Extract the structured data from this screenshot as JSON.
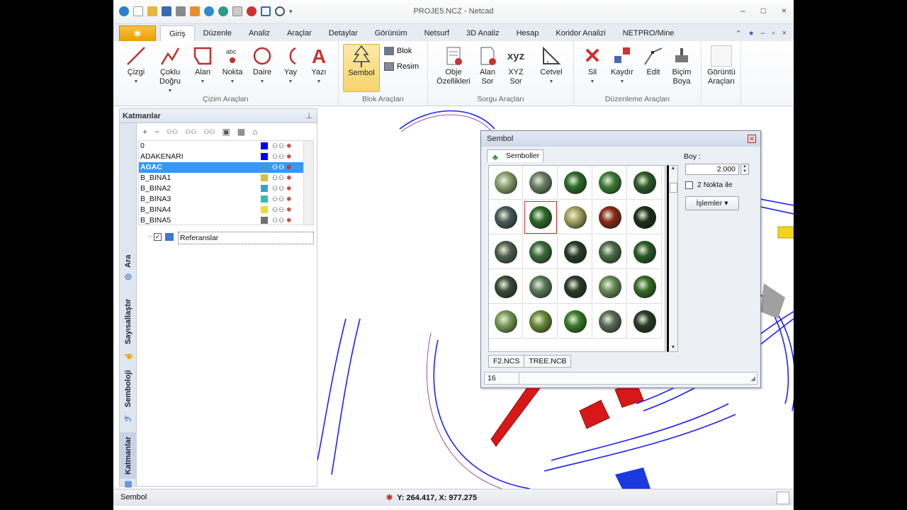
{
  "app": {
    "title": "PROJE5.NCZ - Netcad"
  },
  "window_controls": [
    "–",
    "□",
    "×"
  ],
  "ribbon_tabs": [
    "Giriş",
    "Düzenle",
    "Analiz",
    "Araçlar",
    "Detaylar",
    "Görünüm",
    "Netsurf",
    "3D Analiz",
    "Hesap",
    "Koridor Analizi",
    "NETPRO/Mine"
  ],
  "ribbon": {
    "cizim": {
      "label": "Çizim Araçları",
      "buttons": [
        "Çizgi",
        "Çoklu Doğru",
        "Alan",
        "Nokta",
        "Daire",
        "Yay",
        "Yazı"
      ]
    },
    "blok": {
      "label": "Blok Araçları",
      "sembol": "Sembol",
      "blok": "Blok",
      "resim": "Resim"
    },
    "sorgu": {
      "label": "Sorgu Araçları",
      "buttons": [
        "Obje Özellikleri",
        "Alan Sor",
        "XYZ Sor",
        "Cetvel"
      ]
    },
    "duzenleme": {
      "label": "Düzenleme Araçları",
      "buttons": [
        "Sil",
        "Kaydır",
        "Edit",
        "Biçim Boya"
      ]
    },
    "goruntu": {
      "label": "Görüntü Araçları"
    }
  },
  "layers_panel": {
    "title": "Katmanlar",
    "side_tabs": [
      "Ara",
      "Sayısallaştır",
      "Semboloji",
      "Katmanlar"
    ],
    "layers": [
      {
        "name": "0",
        "color": "#0000ff"
      },
      {
        "name": "ADAKENARI",
        "color": "#0000ff"
      },
      {
        "name": "AGAC",
        "color": "#3aa0c8"
      },
      {
        "name": "B_BINA1",
        "color": "#d8c040"
      },
      {
        "name": "B_BINA2",
        "color": "#3aa0c8"
      },
      {
        "name": "B_BINA3",
        "color": "#30c0a8"
      },
      {
        "name": "B_BINA4",
        "color": "#e8e030"
      },
      {
        "name": "B_BINA5",
        "color": "#707070"
      }
    ],
    "selected_layer": "AGAC",
    "references": "Referanslar"
  },
  "symbol_dialog": {
    "title": "Sembol",
    "tab": "Semboller",
    "size_label": "Boy :",
    "size_value": "2.000",
    "two_point": "2 Nokta ile",
    "actions": "İşlemler",
    "files": [
      "F2.NCS",
      "TREE.NCB"
    ],
    "status_count": "16",
    "symbol_colors": [
      "#8aa070",
      "#6c7e64",
      "#2e6a2a",
      "#3f7a36",
      "#2f5a2a",
      "#4a5a5a",
      "#2f6a2a",
      "#a4a060",
      "#8a2a1a",
      "#1e2e1e",
      "#506050",
      "#3a6a3a",
      "#2a3a2a",
      "#4a6a4a",
      "#2a5a2a",
      "#3a4a3a",
      "#5a7a5a",
      "#2a3a2a",
      "#6a8a5a",
      "#3a6a2a",
      "#7a9a5a",
      "#6a8a3a",
      "#3a7a2a",
      "#5a6a5a",
      "#2a3a2a"
    ]
  },
  "status_bar": {
    "text": "Sembol",
    "coords": "Y: 264.417, X: 977.275"
  }
}
